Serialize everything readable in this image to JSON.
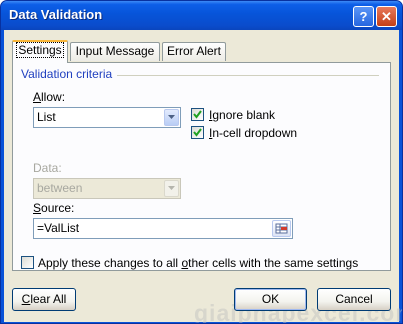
{
  "window": {
    "title": "Data Validation"
  },
  "titlebar": {
    "help_glyph": "?",
    "close_glyph": "✕"
  },
  "tabs": [
    {
      "label": "Settings",
      "active": true
    },
    {
      "label": "Input Message",
      "active": false
    },
    {
      "label": "Error Alert",
      "active": false
    }
  ],
  "settings": {
    "group_title": "Validation criteria",
    "allow": {
      "label_pre": "",
      "label_key": "A",
      "label_post": "llow:",
      "value": "List"
    },
    "data": {
      "label": "Data:",
      "value": "between"
    },
    "ignore_blank": {
      "checked": true,
      "label_pre": "",
      "label_key": "I",
      "label_post": "gnore blank"
    },
    "incell_dropdown": {
      "checked": true,
      "label_pre": "",
      "label_key": "I",
      "label_post": "n-cell dropdown"
    },
    "source": {
      "label_pre": "",
      "label_key": "S",
      "label_post": "ource:",
      "value": "=ValList"
    },
    "apply_all": {
      "checked": false,
      "label_pre": "Apply these changes to all ",
      "label_key": "o",
      "label_post": "ther cells with the same settings"
    }
  },
  "buttons": {
    "clear_all": {
      "pre": "",
      "key": "C",
      "post": "lear All"
    },
    "ok": "OK",
    "cancel": "Cancel"
  },
  "watermark": "giaiphapexcel.com",
  "colors": {
    "title_bar": "#0a53d8",
    "dialog_face": "#ece9d8",
    "group_title": "#1f3fbf",
    "active_tab_accent": "#f9b73b"
  },
  "icons": {
    "collapse": "range-select-icon",
    "dropdown": "chevron-down-icon",
    "check": "check-icon"
  }
}
